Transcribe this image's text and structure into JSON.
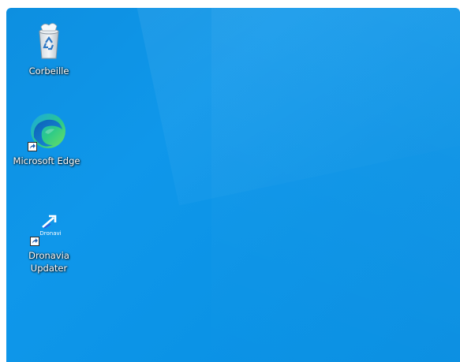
{
  "desktop": {
    "background_color": "#0f97ea",
    "icons": [
      {
        "label": "Corbeille",
        "icon": "recycle-bin-icon",
        "shortcut": false
      },
      {
        "label": "Microsoft Edge",
        "icon": "edge-browser-icon",
        "shortcut": true
      },
      {
        "label": "Dronavia\nUpdater",
        "icon": "dronavia-updater-icon",
        "shortcut": true,
        "icon_text": "Dronavi"
      }
    ]
  }
}
